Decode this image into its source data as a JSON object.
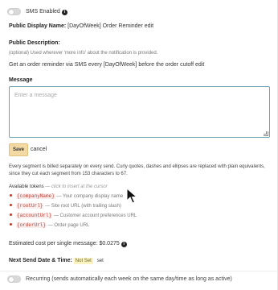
{
  "sms": {
    "label": "SMS Enabled",
    "enabled": false
  },
  "display_name": {
    "label": "Public Display Name:",
    "value": "[DayOfWeek] Order Reminder",
    "edit": "edit"
  },
  "description": {
    "label": "Public Description:",
    "optional_note": "(optional) Used wherever 'more info' about the notification is provided.",
    "value": "Get an order reminder via SMS every [DayOfWeek] before the order cutoff",
    "edit": "edit"
  },
  "message": {
    "label": "Message",
    "placeholder": "Enter a message",
    "value": ""
  },
  "actions": {
    "save": "Save",
    "cancel": "cancel"
  },
  "billing_note": "Every segment is billed separately on every send. Curly quotes, dashes and ellipses are replaced with plain equivalents, since they cut each segment from 153 characters to 67.",
  "tokens": {
    "heading": "Available tokens",
    "hint": "— click to insert at the cursor",
    "items": [
      {
        "token": "{companyName}",
        "desc": "— Your company display name"
      },
      {
        "token": "{rootUrl}",
        "desc": "— Site root URL (with trailing slash)"
      },
      {
        "token": "{accountUrl}",
        "desc": "— Customer account preferences URL"
      },
      {
        "token": "{orderUrl}",
        "desc": "— Order page URL"
      }
    ]
  },
  "cost": {
    "label": "Estimated cost per single message:",
    "value": "$0.0275"
  },
  "next_send": {
    "label": "Next Send Date & Time:",
    "value": "Not Set",
    "set": "set"
  },
  "recurring": {
    "label": "Recurring (sends automatically each week on the same day/time as long as active)",
    "enabled": false
  },
  "colors": {
    "accent": "#6aa3b5",
    "save_button": "#f3d9a3",
    "token": "#c0392b",
    "not_set_badge": "#fbf3c2"
  },
  "icons": {
    "info": "info-circle-icon",
    "cursor": "mouse-pointer-icon"
  }
}
